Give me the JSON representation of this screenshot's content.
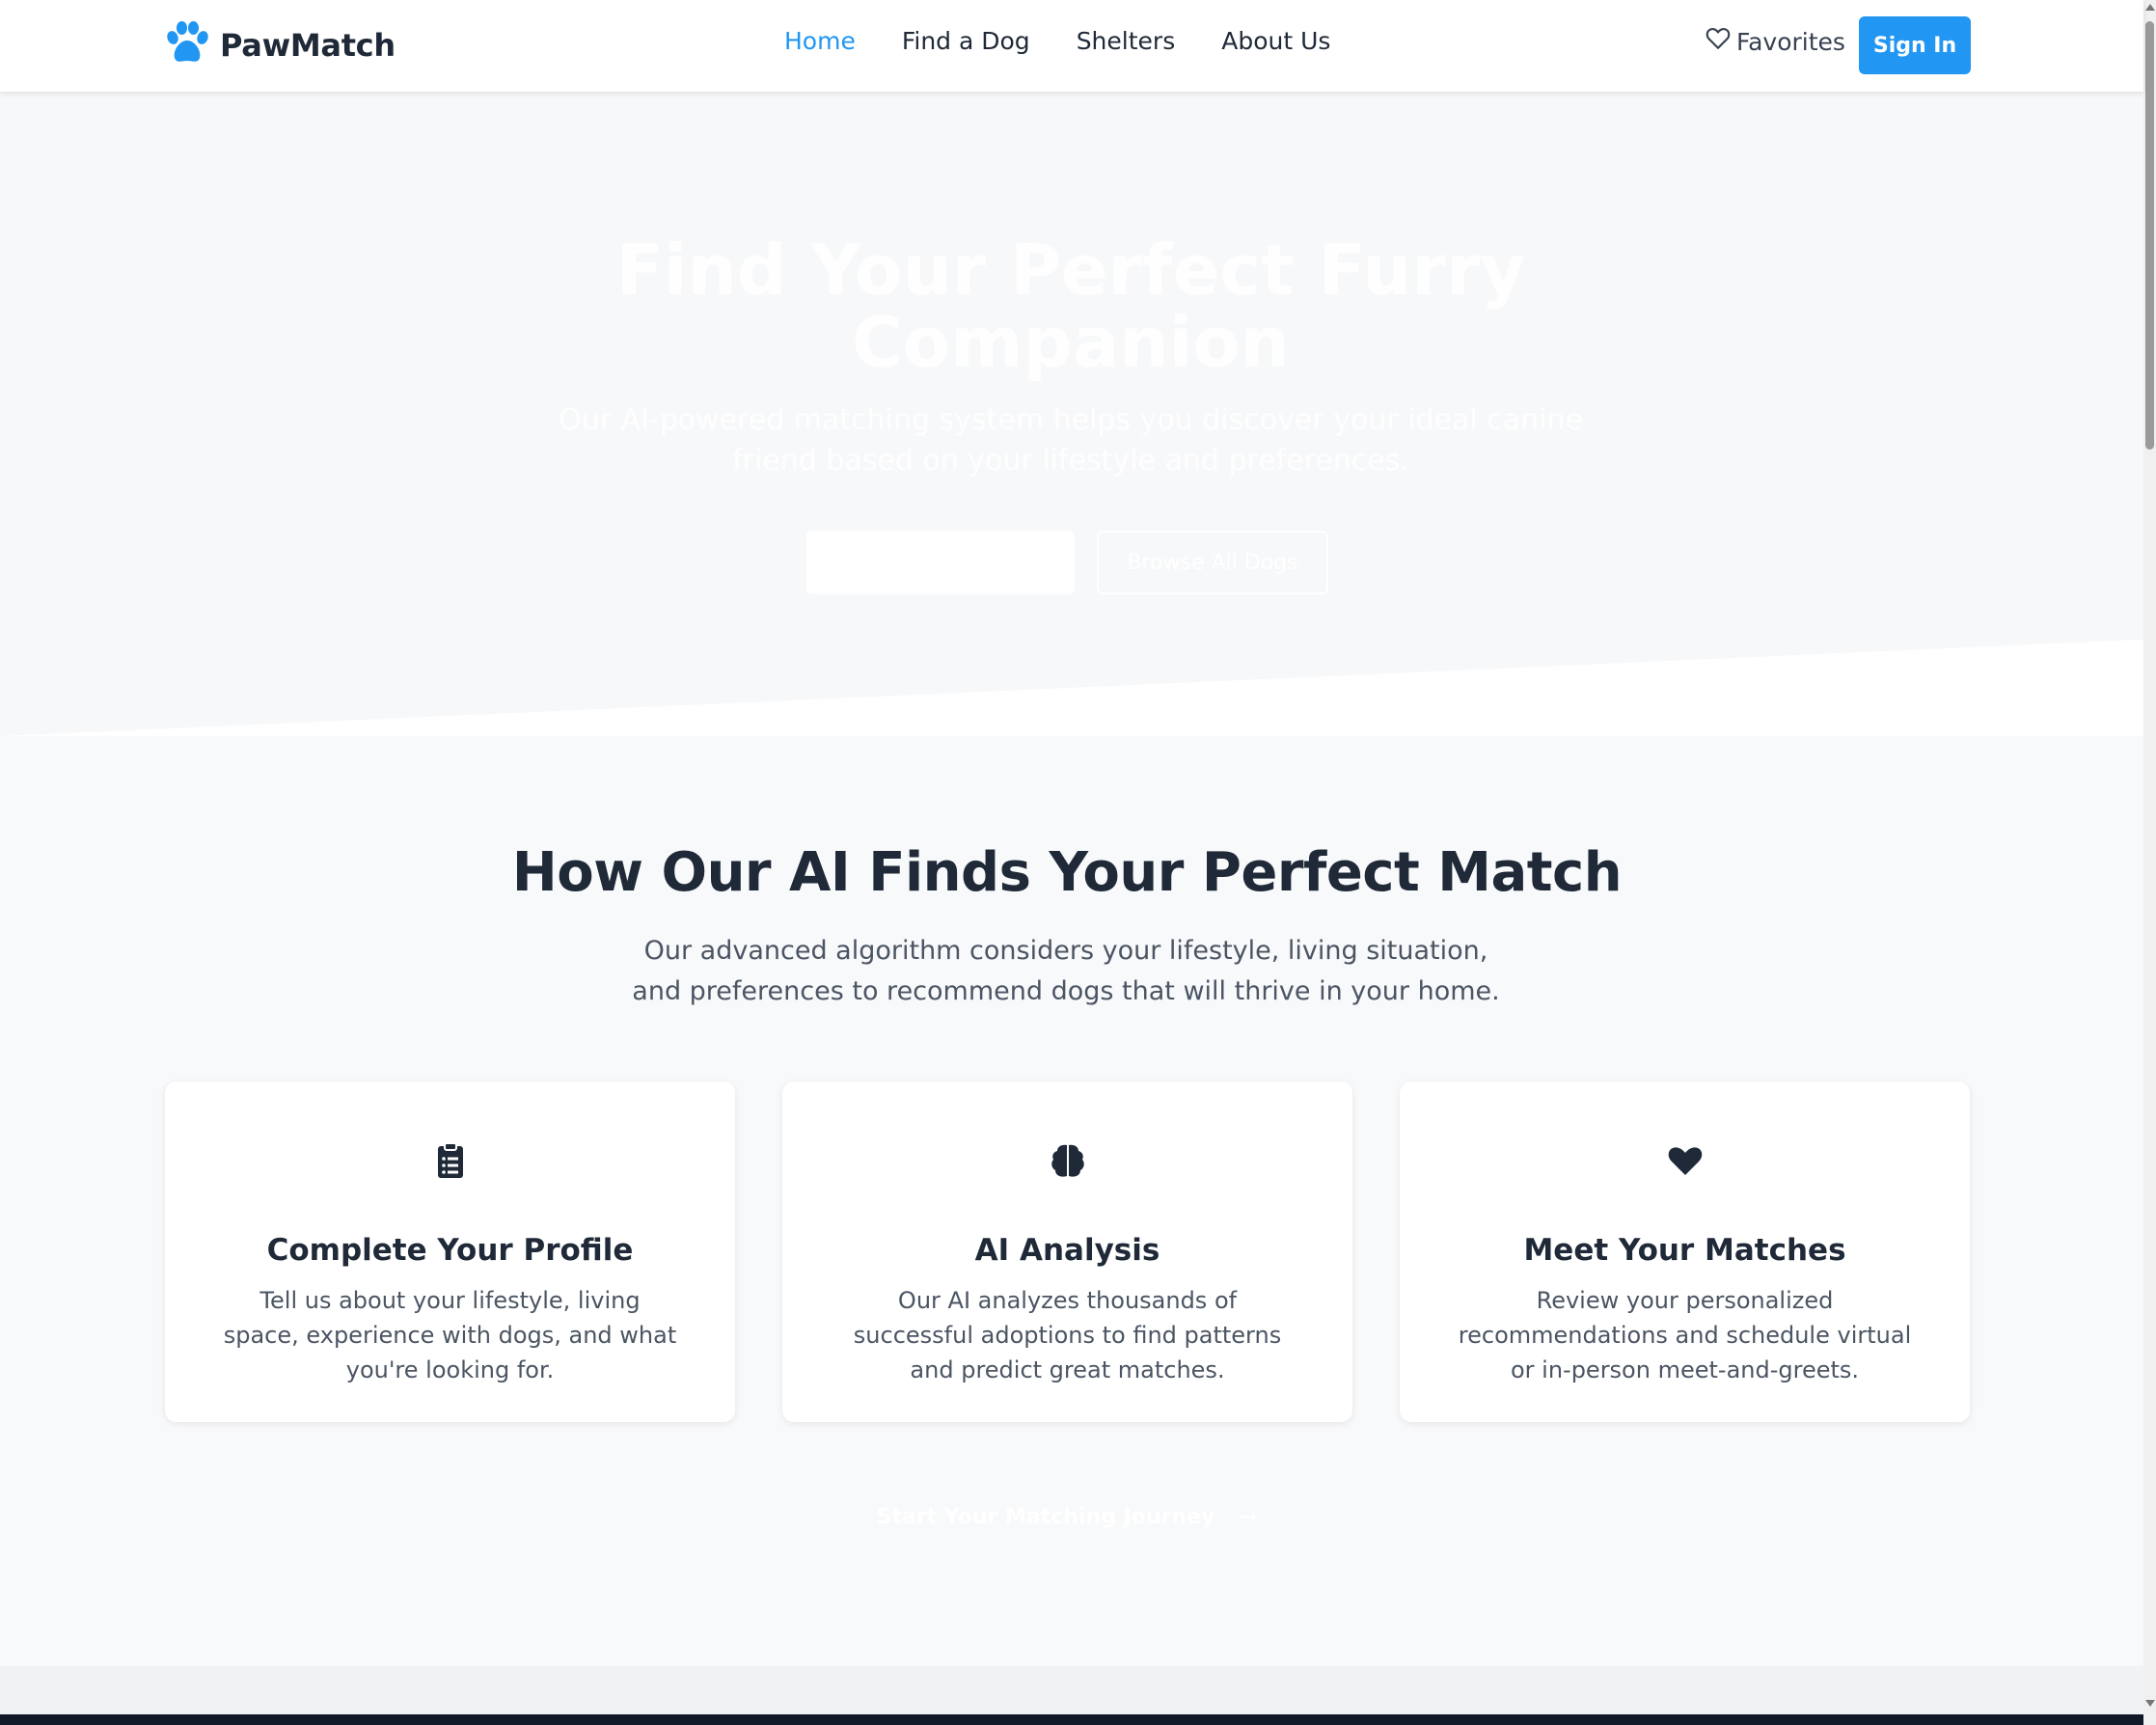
{
  "brand": {
    "name": "PawMatch",
    "color": "#2196f3"
  },
  "nav": {
    "items": [
      {
        "label": "Home",
        "active": true
      },
      {
        "label": "Find a Dog",
        "active": false
      },
      {
        "label": "Shelters",
        "active": false
      },
      {
        "label": "About Us",
        "active": false
      }
    ],
    "favorites_label": "Favorites",
    "signin_label": "Sign In"
  },
  "hero": {
    "title": "Find Your Perfect Furry Companion",
    "subtitle": "Our AI-powered matching system helps you discover your ideal canine friend based on your lifestyle and preferences.",
    "primary_button": "",
    "secondary_button": "Browse All Dogs"
  },
  "how": {
    "title": "How Our AI Finds Your Perfect Match",
    "subtitle": "Our advanced algorithm considers your lifestyle, living situation, and preferences to recommend dogs that will thrive in your home.",
    "cards": [
      {
        "icon": "clipboard-list-icon",
        "title": "Complete Your Profile",
        "text": "Tell us about your lifestyle, living space, experience with dogs, and what you're looking for."
      },
      {
        "icon": "brain-icon",
        "title": "AI Analysis",
        "text": "Our AI analyzes thousands of successful adoptions to find patterns and predict great matches."
      },
      {
        "icon": "heart-icon",
        "title": "Meet Your Matches",
        "text": "Review your personalized recommendations and schedule virtual or in-person meet-and-greets."
      }
    ],
    "cta": "Start Your Matching Journey"
  }
}
